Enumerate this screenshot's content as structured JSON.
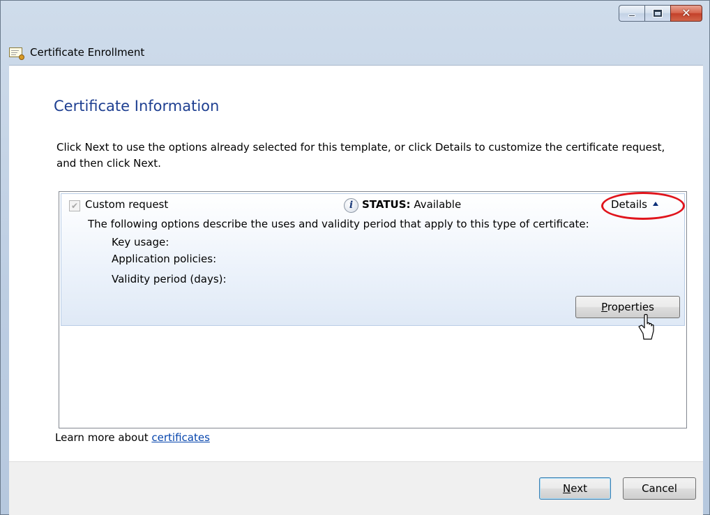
{
  "window": {
    "title": "Certificate Enrollment",
    "controls": [
      "minimize-icon",
      "maximize-icon",
      "close-icon"
    ]
  },
  "page": {
    "title": "Certificate Information",
    "instruction": "Click Next to use the options already selected for this template, or click Details to customize the certificate request, and then click Next."
  },
  "item": {
    "checked": true,
    "name": "Custom request",
    "status_label": "STATUS:",
    "status_value": "Available",
    "details_label": "Details",
    "description": "The following options describe the uses and validity period that apply to this type of certificate:",
    "key_usage_label": "Key usage:",
    "application_policies_label": "Application policies:",
    "validity_period_label": "Validity period (days):",
    "properties_mnemonic": "P",
    "properties_rest": "roperties"
  },
  "learn_more": {
    "prefix": "Learn more about ",
    "link": "certificates"
  },
  "footer": {
    "next_mnemonic": "N",
    "next_rest": "ext",
    "cancel_label": "Cancel"
  },
  "colors": {
    "page_title": "#1e3f91",
    "highlight": "#e0141c",
    "link": "#0645ad"
  }
}
